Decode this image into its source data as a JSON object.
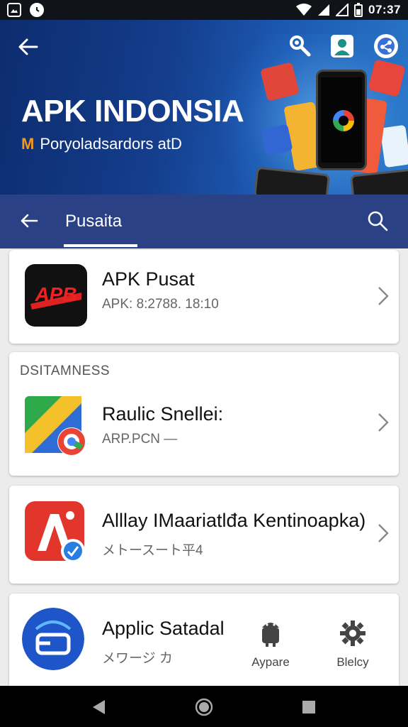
{
  "status_bar": {
    "time": "07:37"
  },
  "hero": {
    "title": "APK INDONSIA",
    "subtitle_mark": "M",
    "subtitle": "Poryoladsardors atD"
  },
  "tab_bar": {
    "active_tab": "Pusaita"
  },
  "apps": [
    {
      "name": "APK Pusat",
      "meta": "APK: 8:2788. 18:10",
      "icon_text": "APB"
    },
    {
      "section": "DSITAMNESS",
      "name": "Raulic Snellei:",
      "meta": "ARP.PCN —"
    },
    {
      "name": "Alllay IMaariatlđa Kentinoapka)",
      "meta": "メトースート平4"
    },
    {
      "name": "Applic Satadal",
      "meta": "メワージ カ"
    }
  ],
  "actions": [
    {
      "label": "Aypare",
      "icon": "android-icon"
    },
    {
      "label": "Blelcy",
      "icon": "gear-icon"
    }
  ],
  "colors": {
    "tab_bar": "#2a4186",
    "hero_dark": "#0d2c6e",
    "accent_orange": "#f29a1f"
  }
}
